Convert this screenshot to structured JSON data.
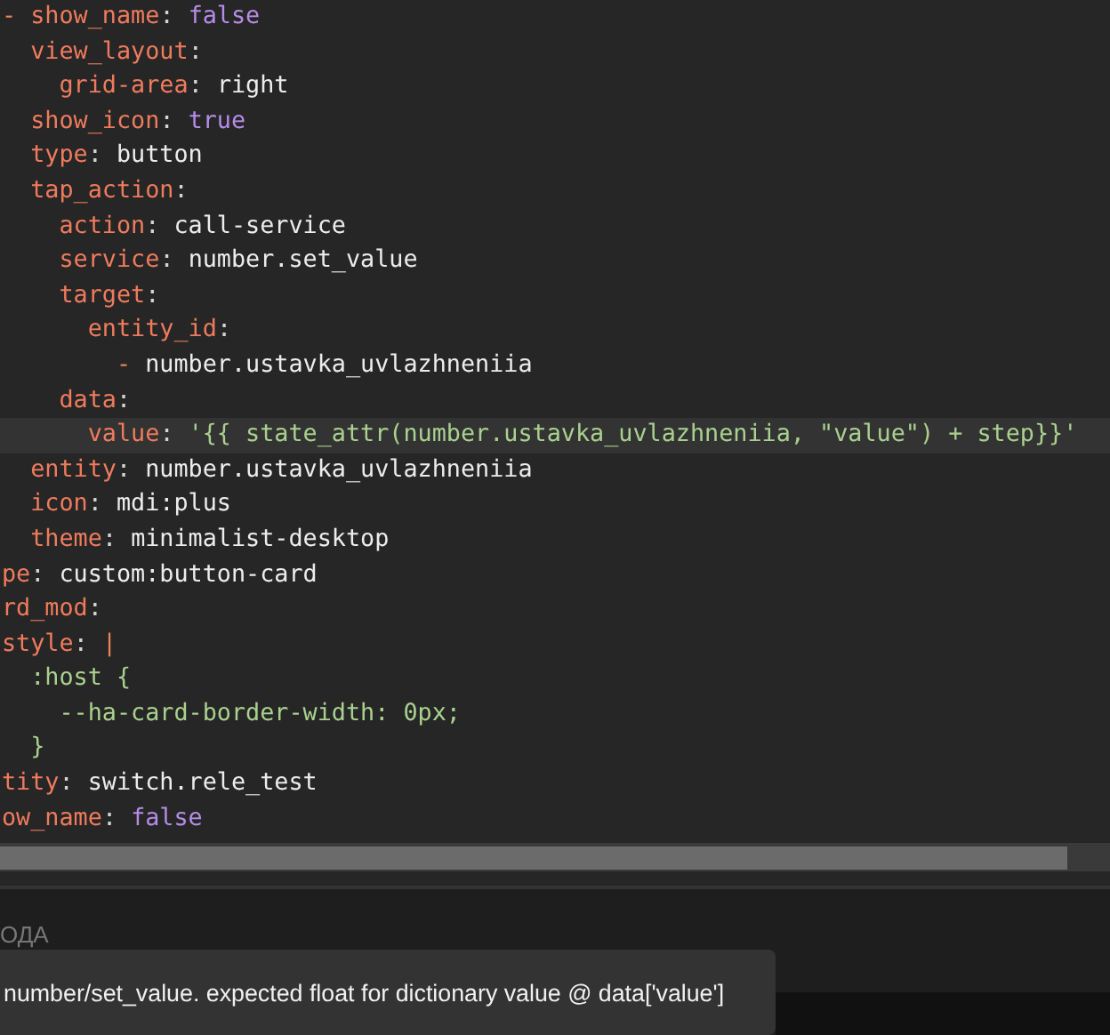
{
  "editor": {
    "lines": [
      {
        "selected": false,
        "tokens": [
          {
            "kind": "dash",
            "text": "- "
          },
          {
            "kind": "key",
            "text": "show_name"
          },
          {
            "kind": "punct",
            "text": ": "
          },
          {
            "kind": "bool",
            "text": "false"
          }
        ]
      },
      {
        "selected": false,
        "tokens": [
          {
            "kind": "key",
            "text": "  view_layout"
          },
          {
            "kind": "punct",
            "text": ":"
          }
        ]
      },
      {
        "selected": false,
        "tokens": [
          {
            "kind": "key",
            "text": "    grid-area"
          },
          {
            "kind": "punct",
            "text": ": "
          },
          {
            "kind": "plain",
            "text": "right"
          }
        ]
      },
      {
        "selected": false,
        "tokens": [
          {
            "kind": "key",
            "text": "  show_icon"
          },
          {
            "kind": "punct",
            "text": ": "
          },
          {
            "kind": "bool",
            "text": "true"
          }
        ]
      },
      {
        "selected": false,
        "tokens": [
          {
            "kind": "key",
            "text": "  type"
          },
          {
            "kind": "punct",
            "text": ": "
          },
          {
            "kind": "plain",
            "text": "button"
          }
        ]
      },
      {
        "selected": false,
        "tokens": [
          {
            "kind": "key",
            "text": "  tap_action"
          },
          {
            "kind": "punct",
            "text": ":"
          }
        ]
      },
      {
        "selected": false,
        "tokens": [
          {
            "kind": "key",
            "text": "    action"
          },
          {
            "kind": "punct",
            "text": ": "
          },
          {
            "kind": "plain",
            "text": "call-service"
          }
        ]
      },
      {
        "selected": false,
        "tokens": [
          {
            "kind": "key",
            "text": "    service"
          },
          {
            "kind": "punct",
            "text": ": "
          },
          {
            "kind": "plain",
            "text": "number.set_value"
          }
        ]
      },
      {
        "selected": false,
        "tokens": [
          {
            "kind": "key",
            "text": "    target"
          },
          {
            "kind": "punct",
            "text": ":"
          }
        ]
      },
      {
        "selected": false,
        "tokens": [
          {
            "kind": "key",
            "text": "      entity_id"
          },
          {
            "kind": "punct",
            "text": ":"
          }
        ]
      },
      {
        "selected": false,
        "tokens": [
          {
            "kind": "dash",
            "text": "        - "
          },
          {
            "kind": "plain",
            "text": "number.ustavka_uvlazhneniia"
          }
        ]
      },
      {
        "selected": false,
        "tokens": [
          {
            "kind": "key",
            "text": "    data"
          },
          {
            "kind": "punct",
            "text": ":"
          }
        ]
      },
      {
        "selected": true,
        "tokens": [
          {
            "kind": "key",
            "text": "      value"
          },
          {
            "kind": "punct",
            "text": ": "
          },
          {
            "kind": "string",
            "text": "'{{ state_attr(number.ustavka_uvlazhneniia, \"value\") + step}}'"
          }
        ]
      },
      {
        "selected": false,
        "tokens": [
          {
            "kind": "key",
            "text": "  entity"
          },
          {
            "kind": "punct",
            "text": ": "
          },
          {
            "kind": "plain",
            "text": "number.ustavka_uvlazhneniia"
          }
        ]
      },
      {
        "selected": false,
        "tokens": [
          {
            "kind": "key",
            "text": "  icon"
          },
          {
            "kind": "punct",
            "text": ": "
          },
          {
            "kind": "plain",
            "text": "mdi:plus"
          }
        ]
      },
      {
        "selected": false,
        "tokens": [
          {
            "kind": "key",
            "text": "  theme"
          },
          {
            "kind": "punct",
            "text": ": "
          },
          {
            "kind": "plain",
            "text": "minimalist-desktop"
          }
        ]
      },
      {
        "selected": false,
        "tokens": [
          {
            "kind": "key",
            "text": "pe"
          },
          {
            "kind": "punct",
            "text": ": "
          },
          {
            "kind": "plain",
            "text": "custom:button-card"
          }
        ]
      },
      {
        "selected": false,
        "tokens": [
          {
            "kind": "key",
            "text": "rd_mod"
          },
          {
            "kind": "punct",
            "text": ":"
          }
        ]
      },
      {
        "selected": false,
        "tokens": [
          {
            "kind": "key",
            "text": "style"
          },
          {
            "kind": "punct",
            "text": ": "
          },
          {
            "kind": "dash",
            "text": "|"
          }
        ]
      },
      {
        "selected": false,
        "tokens": [
          {
            "kind": "string",
            "text": "  :host {"
          }
        ]
      },
      {
        "selected": false,
        "tokens": [
          {
            "kind": "string",
            "text": "    --ha-card-border-width: 0px;"
          }
        ]
      },
      {
        "selected": false,
        "tokens": [
          {
            "kind": "string",
            "text": "  }"
          }
        ]
      },
      {
        "selected": false,
        "tokens": [
          {
            "kind": "key",
            "text": "tity"
          },
          {
            "kind": "punct",
            "text": ": "
          },
          {
            "kind": "plain",
            "text": "switch.rele_test"
          }
        ]
      },
      {
        "selected": false,
        "tokens": [
          {
            "kind": "key",
            "text": "ow_name"
          },
          {
            "kind": "punct",
            "text": ": "
          },
          {
            "kind": "bool",
            "text": "false"
          }
        ]
      }
    ]
  },
  "panel": {
    "label": "ОДА"
  },
  "toast": {
    "message": "number/set_value. expected float for dictionary value @ data['value']"
  }
}
